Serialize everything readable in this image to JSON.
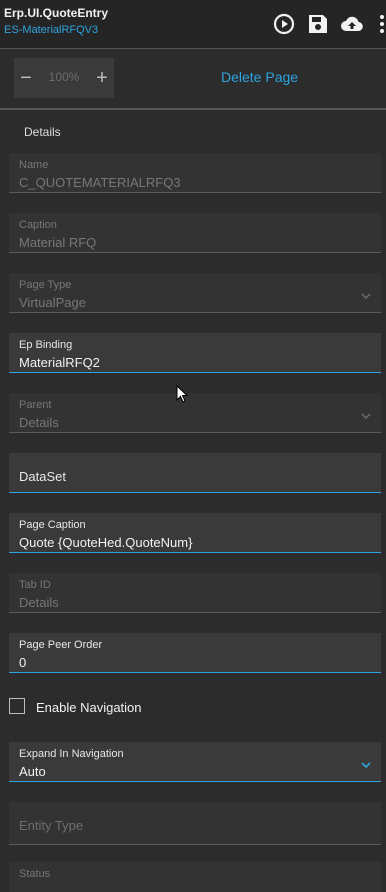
{
  "header": {
    "title": "Erp.UI.QuoteEntry",
    "subtitle": "ES-MaterialRFQV3",
    "icons": [
      "play-circle-icon",
      "save-icon",
      "cloud-upload-icon",
      "more-vertical-icon"
    ]
  },
  "toolbar": {
    "zoom_value": "100%",
    "zoom_minus": "−",
    "zoom_plus": "+",
    "delete_page": "Delete Page"
  },
  "section": {
    "title": "Details"
  },
  "fields": {
    "name": {
      "label": "Name",
      "value": "C_QUOTEMATERIALRFQ3"
    },
    "caption": {
      "label": "Caption",
      "value": "Material RFQ"
    },
    "page_type": {
      "label": "Page Type",
      "value": "VirtualPage"
    },
    "ep_binding": {
      "label": "Ep Binding",
      "value": "MaterialRFQ2"
    },
    "parent": {
      "label": "Parent",
      "value": "Details"
    },
    "dataset": {
      "placeholder": "DataSet"
    },
    "page_caption": {
      "label": "Page Caption",
      "value": "Quote {QuoteHed.QuoteNum}"
    },
    "tab_id": {
      "label": "Tab ID",
      "value": "Details"
    },
    "page_peer_order": {
      "label": "Page Peer Order",
      "value": "0"
    },
    "enable_navigation": {
      "label": "Enable Navigation",
      "checked": false
    },
    "expand_in_navigation": {
      "label": "Expand In Navigation",
      "value": "Auto"
    },
    "entity_type": {
      "placeholder": "Entity Type"
    },
    "status": {
      "label": "Status"
    }
  },
  "colors": {
    "accent": "#2ea3dd",
    "background": "#2c2c2c",
    "field": "#333333"
  }
}
